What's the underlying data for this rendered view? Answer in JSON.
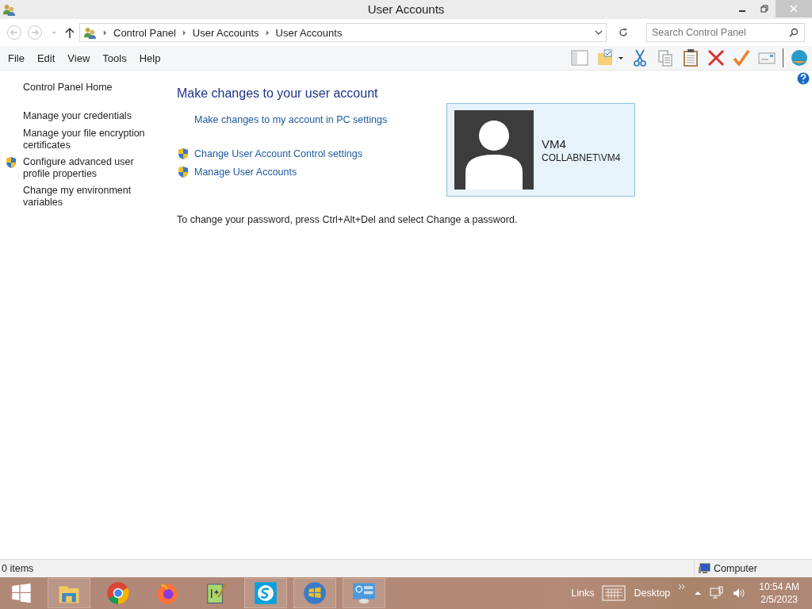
{
  "window": {
    "title": "User Accounts"
  },
  "address": {
    "breadcrumbs": [
      "Control Panel",
      "User Accounts",
      "User Accounts"
    ],
    "search_placeholder": "Search Control Panel"
  },
  "menu": [
    "File",
    "Edit",
    "View",
    "Tools",
    "Help"
  ],
  "sidebar": {
    "items": [
      {
        "label": "Control Panel Home",
        "shield": false
      },
      {
        "label": "Manage your credentials",
        "shield": false
      },
      {
        "label": "Manage your file encryption certificates",
        "shield": false
      },
      {
        "label": "Configure advanced user profile properties",
        "shield": true
      },
      {
        "label": "Change my environment variables",
        "shield": false
      }
    ]
  },
  "main": {
    "heading": "Make changes to your user account",
    "tasks": [
      {
        "label": "Make changes to my account in PC settings",
        "shield": false
      },
      {
        "label": "Change User Account Control settings",
        "shield": true
      },
      {
        "label": "Manage User Accounts",
        "shield": true
      }
    ],
    "note": "To change your password, press Ctrl+Alt+Del and select Change a password.",
    "account": {
      "name": "VM4",
      "domain": "COLLABNET\\VM4"
    }
  },
  "status_bar": {
    "items": "0 items",
    "zone": "Computer"
  },
  "taskbar": {
    "apps": [
      {
        "kind": "explorer",
        "open": true
      },
      {
        "kind": "chrome",
        "open": false
      },
      {
        "kind": "firefox",
        "open": false
      },
      {
        "kind": "notepad",
        "open": false
      },
      {
        "kind": "skype",
        "open": true
      },
      {
        "kind": "windows",
        "open": true
      },
      {
        "kind": "panel",
        "open": true
      }
    ],
    "toolbars": [
      "Links",
      "Desktop"
    ],
    "time": "10:54 AM",
    "date": "2/5/2023"
  }
}
